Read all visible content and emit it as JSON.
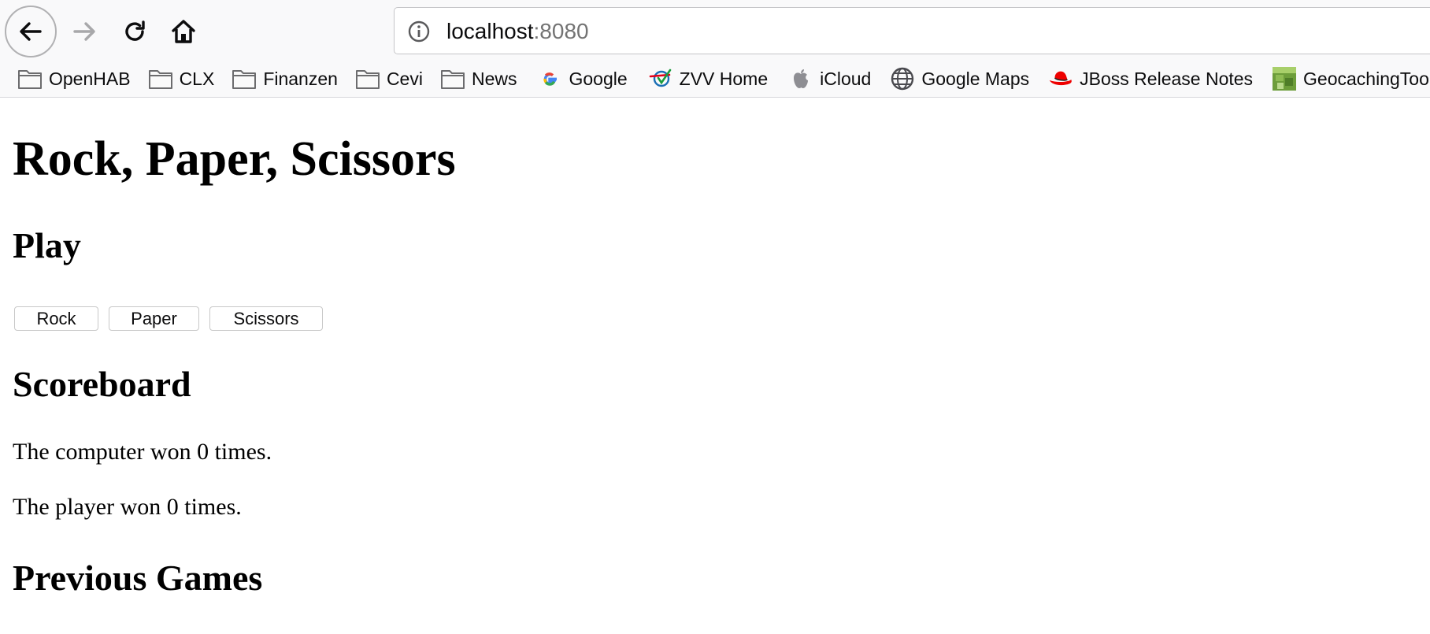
{
  "browser": {
    "url_host": "localhost",
    "url_port": ":8080",
    "bookmarks": [
      {
        "label": "OpenHAB",
        "icon": "folder-icon"
      },
      {
        "label": "CLX",
        "icon": "folder-icon"
      },
      {
        "label": "Finanzen",
        "icon": "folder-icon"
      },
      {
        "label": "Cevi",
        "icon": "folder-icon"
      },
      {
        "label": "News",
        "icon": "folder-icon"
      },
      {
        "label": "Google",
        "icon": "google-icon"
      },
      {
        "label": "ZVV Home",
        "icon": "zvv-icon"
      },
      {
        "label": "iCloud",
        "icon": "apple-icon"
      },
      {
        "label": "Google Maps",
        "icon": "globe-icon"
      },
      {
        "label": "JBoss Release Notes",
        "icon": "redhat-icon"
      },
      {
        "label": "GeocachingToo",
        "icon": "geocaching-icon"
      }
    ]
  },
  "page": {
    "title": "Rock, Paper, Scissors",
    "play_heading": "Play",
    "buttons": {
      "rock": "Rock",
      "paper": "Paper",
      "scissors": "Scissors"
    },
    "scoreboard_heading": "Scoreboard",
    "computer_score_text": "The computer won 0 times.",
    "player_score_text": "The player won 0 times.",
    "previous_games_heading": "Previous Games"
  }
}
